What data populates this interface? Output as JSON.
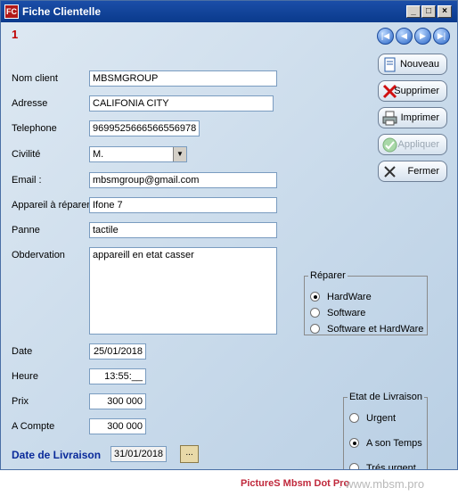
{
  "window": {
    "title": "Fiche Clientelle",
    "app_icon_text": "FC",
    "min": "_",
    "max": "□",
    "close": "×"
  },
  "record_number": "1",
  "nav": {
    "first": "|◀",
    "prev": "◀",
    "next": "▶",
    "last": "▶|"
  },
  "buttons": {
    "nouveau": "Nouveau",
    "supprimer": "Supprimer",
    "imprimer": "Imprimer",
    "appliquer": "Appliquer",
    "fermer": "Fermer"
  },
  "form": {
    "nom_client": {
      "label": "Nom client",
      "value": "MBSMGROUP"
    },
    "adresse": {
      "label": "Adresse",
      "value": "CALIFONIA CITY"
    },
    "telephone": {
      "label": "Telephone",
      "value": "9699525666566556978"
    },
    "civilite": {
      "label": "Civilité",
      "value": "M."
    },
    "email": {
      "label": "Email :",
      "value": "mbsmgroup@gmail.com"
    },
    "appareil": {
      "label": "Appareil à réparer",
      "value": "Ifone 7"
    },
    "panne": {
      "label": "Panne",
      "value": "tactile"
    },
    "observation": {
      "label": "Obdervation",
      "value": "appareill en etat casser"
    },
    "date": {
      "label": "Date",
      "value": "25/01/2018"
    },
    "heure": {
      "label": "Heure",
      "value": "13:55:__"
    },
    "prix": {
      "label": "Prix",
      "value": "300 000"
    },
    "acompte": {
      "label": "A Compte",
      "value": "300 000"
    },
    "date_livraison": {
      "label": "Date de Livraison",
      "value": "31/01/2018",
      "picker": "..."
    }
  },
  "reparer": {
    "legend": "Réparer",
    "options": [
      "HardWare",
      "Software",
      "Software et HardWare"
    ],
    "selected_index": 0
  },
  "etat_livraison": {
    "legend": "Etat de Livraison",
    "options": [
      "Urgent",
      "A son Temps",
      "Trés urgent"
    ],
    "selected_index": 1
  },
  "watermark": {
    "text": "PictureS Mbsm Dot Pro",
    "site": ": www.mbsm.pro"
  },
  "colors": {
    "accent": "#0a3a8c",
    "record": "#c00000",
    "delivery_label": "#0a2a9a"
  }
}
